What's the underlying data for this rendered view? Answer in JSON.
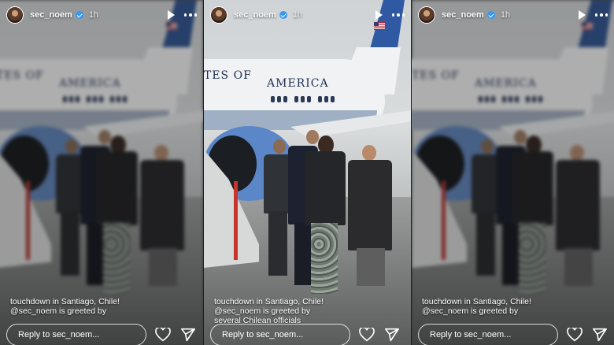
{
  "story": {
    "username": "sec_noem",
    "time": "1h",
    "caption_lines": [
      "touchdown in Santiago, Chile!",
      "is greeted by",
      "several Chilean officials"
    ],
    "mention": "@sec_noem",
    "reply_placeholder": "Reply to sec_noem...",
    "fuselage_text_1": "TES OF",
    "fuselage_text_2": "AMERICA"
  },
  "icons": [
    "play-icon",
    "more-icon",
    "verified-icon",
    "heart-icon",
    "send-icon"
  ],
  "colors": {
    "verified": "#3897f0",
    "tail": "#2f5aa3",
    "engine": "#5b86c7"
  }
}
